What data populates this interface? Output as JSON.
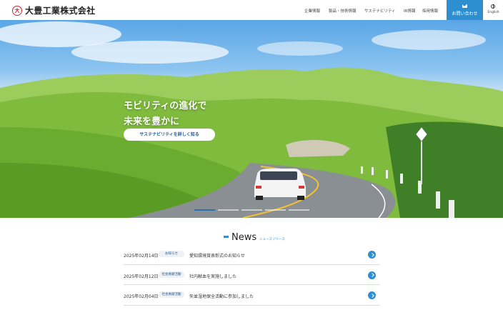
{
  "header": {
    "logo_text": "大豊工業株式会社",
    "logo_mark": "大",
    "nav": [
      {
        "label": "企業情報"
      },
      {
        "label": "製品・技術情報"
      },
      {
        "label": "サステナビリティ"
      },
      {
        "label": "IR情報"
      },
      {
        "label": "採用情報"
      }
    ],
    "contact_label": "お問い合わせ",
    "lang_label": "English"
  },
  "hero": {
    "title_line1": "モビリティの進化で",
    "title_line2": "未来を豊かに",
    "button_label": "サステナビリティを詳しく知る",
    "slides": 5,
    "active_slide": 1
  },
  "news": {
    "title": "News",
    "subtitle": "ニュースリリース",
    "items": [
      {
        "date": "2025年02月14日",
        "category": "お知らせ",
        "text": "愛知環境賞表彰式のお知らせ"
      },
      {
        "date": "2025年02月12日",
        "category": "社会貢献活動",
        "text": "社内献血を実施しました"
      },
      {
        "date": "2025年02月04日",
        "category": "社会貢献活動",
        "text": "矢並湿地保全活動に参加しました"
      }
    ]
  },
  "colors": {
    "accent": "#2d8fd0",
    "logo_red": "#c9252c"
  }
}
